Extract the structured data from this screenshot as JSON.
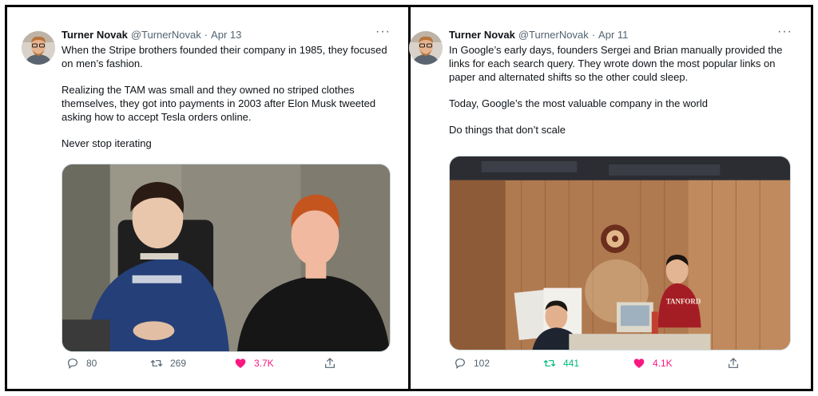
{
  "tweets": [
    {
      "author_name": "Turner Novak",
      "author_handle": "@TurnerNovak",
      "separator": "·",
      "date": "Apr 13",
      "more": "···",
      "paragraphs": [
        "When the Stripe brothers founded their company in 1985, they focused on men’s fashion.",
        "Realizing the TAM was small and they owned no striped clothes themselves, they got into payments in 2003 after Elon Musk tweeted asking how to accept Tesla orders online.",
        "Never stop iterating"
      ],
      "replies": "80",
      "retweets": "269",
      "likes": "3.7K",
      "liked": true,
      "retweeted": false
    },
    {
      "author_name": "Turner Novak",
      "author_handle": "@TurnerNovak",
      "separator": "·",
      "date": "Apr 11",
      "more": "···",
      "paragraphs": [
        "In Google’s early days, founders Sergei and Brian manually provided the links for each search query. They wrote down the most popular links on paper and alternated shifts so the other could sleep.",
        "Today, Google’s the most valuable company in the world",
        "Do things that don’t scale"
      ],
      "photo_text": "TANFORD",
      "replies": "102",
      "retweets": "441",
      "likes": "4.1K",
      "liked": true,
      "retweeted": true
    }
  ],
  "colors": {
    "text": "#0f1419",
    "secondary": "#536471",
    "like": "#f91880",
    "retweet": "#00ba7c",
    "border": "#000000"
  },
  "icons": [
    "avatar",
    "more-icon",
    "reply-icon",
    "retweet-icon",
    "heart-icon",
    "share-icon"
  ]
}
